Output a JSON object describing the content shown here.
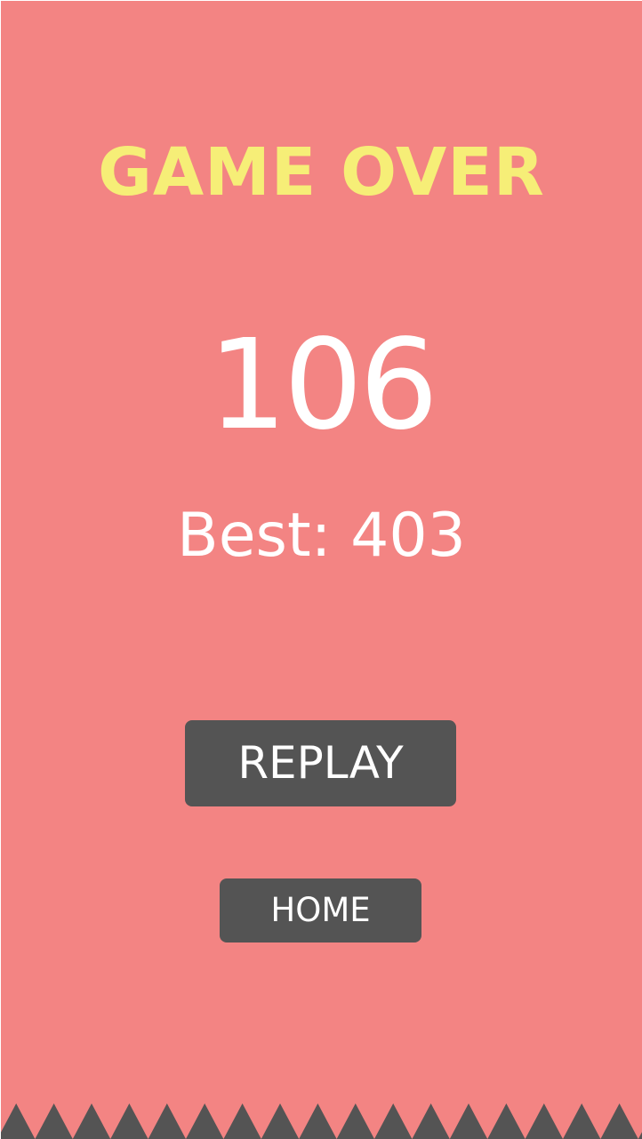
{
  "game_over": {
    "title": "GAME OVER",
    "score": "106",
    "best_label": "Best: 403"
  },
  "buttons": {
    "replay_label": "REPLAY",
    "home_label": "HOME"
  },
  "colors": {
    "background": "#f38483",
    "title": "#f6ee77",
    "button": "#545454",
    "spikes": "#545454",
    "text": "#ffffff"
  },
  "decorations": {
    "spikes": "spike-row-hazard"
  }
}
